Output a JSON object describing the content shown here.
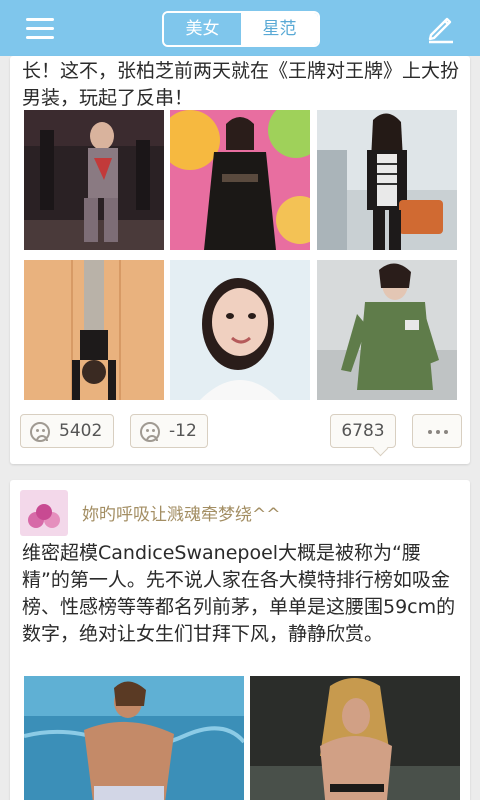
{
  "header": {
    "tabs": [
      {
        "label": "美女",
        "active": true
      },
      {
        "label": "星范",
        "active": false
      }
    ],
    "menu_icon": "hamburger-menu-icon",
    "edit_icon": "pencil-edit-icon",
    "bar_color": "#7fc6ec"
  },
  "posts": [
    {
      "text": "长！这不，张柏芝前两天就在《王牌对王牌》上大扮男装，玩起了反串！",
      "images": 6,
      "likes": "5402",
      "dislikes": "-12",
      "comments": "6783"
    },
    {
      "username": "妳旳呼吸让溅魂牵梦绕^^",
      "text": "维密超模CandiceSwanepoel大概是被称为“腰精”的第一人。先不说人家在各大模特排行榜如吸金榜、性感榜等等都名列前茅，单单是这腰围59cm的数字，绝对让女生们甘拜下风，静静欣赏。"
    }
  ]
}
